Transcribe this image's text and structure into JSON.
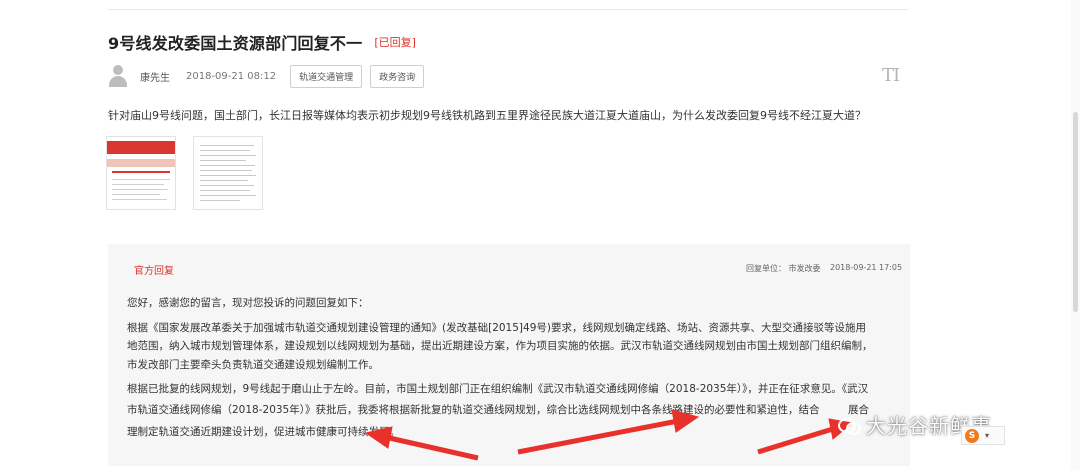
{
  "post": {
    "title": "9号线发改委国土资源部门回复不一",
    "status_badge": "[已回复]",
    "author": "康先生",
    "datetime": "2018-09-21 08:12",
    "tags": [
      "轨道交通管理",
      "政务咨询"
    ],
    "font_size_icon_label": "TI",
    "question": "针对庙山9号线问题，国土部门，长江日报等媒体均表示初步规划9号线铁机路到五里界途径民族大道江夏大道庙山，为什么发改委回复9号线不经江夏大道？"
  },
  "reply": {
    "header": "官方回复",
    "unit": "回复单位：  市发改委",
    "time": "2018-09-21 17:05",
    "lines": [
      "您好，感谢您的留言，现对您投诉的问题回复如下：",
      "    根据《国家发展改革委关于加强城市轨道交通规划建设管理的通知》(发改基础[2015]49号)要求，线网规划确定线路、场站、资源共享、大型交通接驳等设施用",
      "地范围，纳入城市规划管理体系，建设规划以线网规划为基础，提出近期建设方案，作为项目实施的依据。武汉市轨道交通线网规划由市国土规划部门组织编制，",
      "市发改部门主要牵头负责轨道交通建设规划编制工作。",
      "根据已批复的线网规划，9号线起于磨山止于左岭。目前，市国土规划部门正在组织编制《武汉市轨道交通线网修编（2018-2035年）》，并正在征求意见。《武汉",
      "市轨道交通线网修编（2018-2035年）》获批后，我委将根据新批复的轨道交通线网规划，综合比选线网规划中各条线路建设的必要性和紧迫性，结合",
      "理制定轨道交通近期建设计划，促进城市健康可持续发展。"
    ],
    "line6_tail": "展合"
  },
  "watermark": {
    "text": "大光谷新鲜事"
  },
  "ime": {
    "logo": "S"
  },
  "colors": {
    "accent_red": "#e0302c",
    "reply_bg": "#f6f6f6",
    "arrow_red": "#e8312a"
  }
}
